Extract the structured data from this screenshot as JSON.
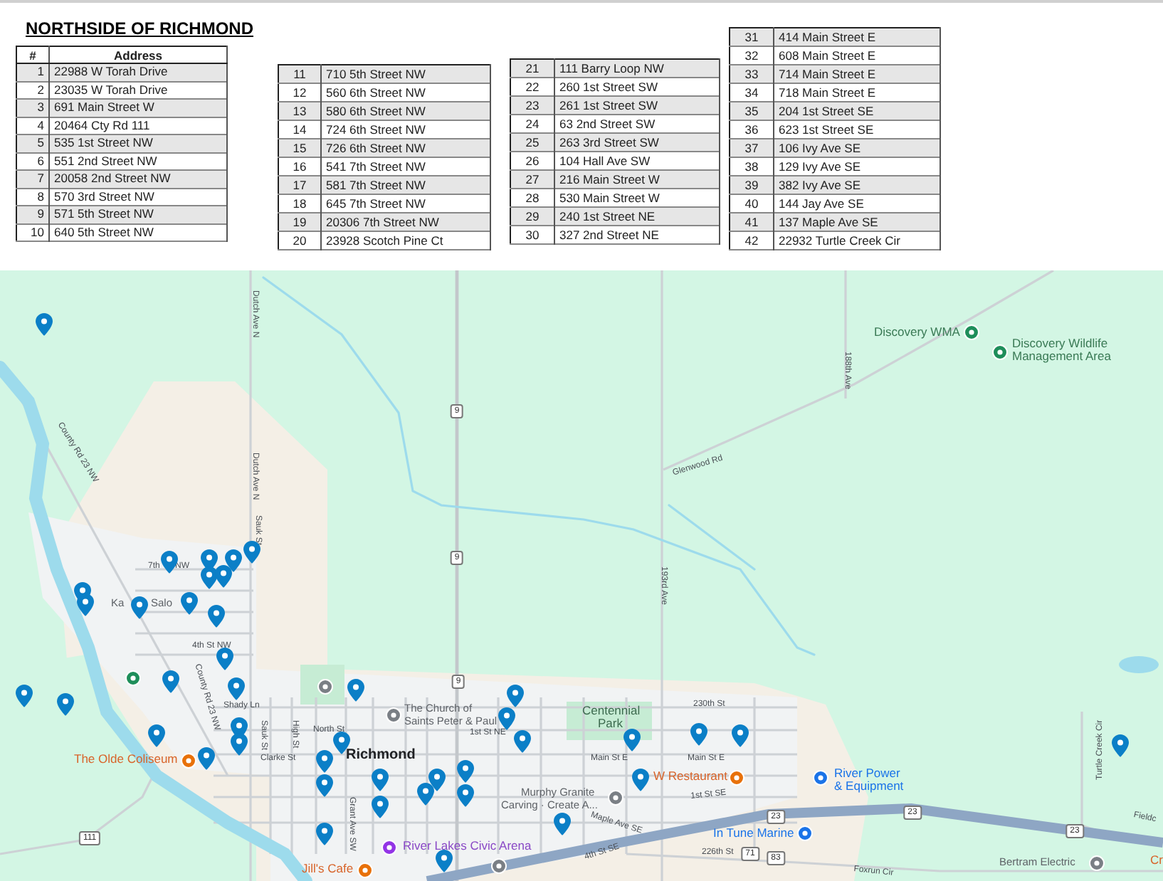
{
  "title": "NORTHSIDE OF RICHMOND",
  "tables": [
    {
      "columns": [
        "#",
        "Address"
      ],
      "rows": [
        {
          "num": "1",
          "address": "22988 W Torah Drive"
        },
        {
          "num": "2",
          "address": "23035 W Torah Drive"
        },
        {
          "num": "3",
          "address": "691 Main Street W"
        },
        {
          "num": "4",
          "address": "20464 Cty Rd 111"
        },
        {
          "num": "5",
          "address": "535 1st Street NW"
        },
        {
          "num": "6",
          "address": "551 2nd Street NW"
        },
        {
          "num": "7",
          "address": "20058 2nd Street NW"
        },
        {
          "num": "8",
          "address": "570 3rd Street NW"
        },
        {
          "num": "9",
          "address": "571 5th Street NW"
        },
        {
          "num": "10",
          "address": "640 5th Street NW"
        }
      ]
    },
    {
      "rows": [
        {
          "num": "11",
          "address": "710 5th Street NW"
        },
        {
          "num": "12",
          "address": "560 6th Street NW"
        },
        {
          "num": "13",
          "address": "580 6th Street NW"
        },
        {
          "num": "14",
          "address": "724 6th Street NW"
        },
        {
          "num": "15",
          "address": "726 6th Street NW"
        },
        {
          "num": "16",
          "address": "541 7th Street NW"
        },
        {
          "num": "17",
          "address": "581 7th Street NW"
        },
        {
          "num": "18",
          "address": "645 7th Street NW"
        },
        {
          "num": "19",
          "address": "20306 7th Street NW"
        },
        {
          "num": "20",
          "address": "23928 Scotch Pine Ct"
        }
      ]
    },
    {
      "rows": [
        {
          "num": "21",
          "address": "111 Barry Loop NW"
        },
        {
          "num": "22",
          "address": "260 1st Street SW"
        },
        {
          "num": "23",
          "address": "261 1st Street SW"
        },
        {
          "num": "24",
          "address": "63 2nd Street SW"
        },
        {
          "num": "25",
          "address": "263 3rd Street SW"
        },
        {
          "num": "26",
          "address": "104 Hall Ave SW"
        },
        {
          "num": "27",
          "address": "216 Main Street W"
        },
        {
          "num": "28",
          "address": "530 Main Street W"
        },
        {
          "num": "29",
          "address": "240 1st Street NE"
        },
        {
          "num": "30",
          "address": "327 2nd Street NE"
        }
      ]
    },
    {
      "rows": [
        {
          "num": "31",
          "address": "414 Main Street E"
        },
        {
          "num": "32",
          "address": "608 Main Street E"
        },
        {
          "num": "33",
          "address": "714 Main Street E"
        },
        {
          "num": "34",
          "address": "718 Main Street E"
        },
        {
          "num": "35",
          "address": "204 1st Street SE"
        },
        {
          "num": "36",
          "address": "623 1st Street SE"
        },
        {
          "num": "37",
          "address": "106 Ivy Ave SE"
        },
        {
          "num": "38",
          "address": "129 Ivy Ave SE"
        },
        {
          "num": "39",
          "address": "382 Ivy Ave SE"
        },
        {
          "num": "40",
          "address": "144 Jay Ave SE"
        },
        {
          "num": "41",
          "address": "137 Maple Ave SE"
        },
        {
          "num": "42",
          "address": "22932 Turtle Creek Cir"
        }
      ]
    }
  ],
  "map": {
    "labels": [
      {
        "text": "Dutch Ave N",
        "kind": "road"
      },
      {
        "text": "Discovery WMA",
        "kind": "poi-green"
      },
      {
        "text": "Discovery Wildlife",
        "kind": "poi-green"
      },
      {
        "text": "Management Area",
        "kind": "poi-green"
      },
      {
        "text": "188th Ave",
        "kind": "road"
      },
      {
        "text": "County Rd 23 NW",
        "kind": "road"
      },
      {
        "text": "Glenwood Rd",
        "kind": "road"
      },
      {
        "text": "Dutch Ave N",
        "kind": "road"
      },
      {
        "text": "Sauk St",
        "kind": "road"
      },
      {
        "text": "7th",
        "kind": "road"
      },
      {
        "text": "NW",
        "kind": "road"
      },
      {
        "text": "Ka",
        "kind": "place"
      },
      {
        "text": "Salo",
        "kind": "place"
      },
      {
        "text": "4th St NW",
        "kind": "road"
      },
      {
        "text": "193rd Ave",
        "kind": "road"
      },
      {
        "text": "Shady Ln",
        "kind": "road"
      },
      {
        "text": "230th St",
        "kind": "road"
      },
      {
        "text": "The Church of",
        "kind": "place"
      },
      {
        "text": "Saints Peter & Paul",
        "kind": "place"
      },
      {
        "text": "Centennial",
        "kind": "park"
      },
      {
        "text": "Park",
        "kind": "park"
      },
      {
        "text": "County Rd 23 NW",
        "kind": "road"
      },
      {
        "text": "Sauk St",
        "kind": "road"
      },
      {
        "text": "High St",
        "kind": "road"
      },
      {
        "text": "North St",
        "kind": "road"
      },
      {
        "text": "1st St NE",
        "kind": "road"
      },
      {
        "text": "The Olde Coliseum",
        "kind": "poi-orange"
      },
      {
        "text": "Clarke St",
        "kind": "road"
      },
      {
        "text": "Richmond",
        "kind": "town"
      },
      {
        "text": "Main St E",
        "kind": "road"
      },
      {
        "text": "Main St E",
        "kind": "road"
      },
      {
        "text": "W Restaurant",
        "kind": "poi-orange"
      },
      {
        "text": "River Power",
        "kind": "poi-blue"
      },
      {
        "text": "& Equipment",
        "kind": "poi-blue"
      },
      {
        "text": "Murphy Granite",
        "kind": "place"
      },
      {
        "text": "Carving · Create A...",
        "kind": "place"
      },
      {
        "text": "1st St SE",
        "kind": "road"
      },
      {
        "text": "Turtle Creek Cir",
        "kind": "road"
      },
      {
        "text": "Fieldc",
        "kind": "road"
      },
      {
        "text": "Maple Ave SE",
        "kind": "road"
      },
      {
        "text": "In Tune Marine",
        "kind": "poi-blue"
      },
      {
        "text": "Grant Ave SW",
        "kind": "road"
      },
      {
        "text": "River Lakes Civic Arena",
        "kind": "poi-purple"
      },
      {
        "text": "4th St SE",
        "kind": "road"
      },
      {
        "text": "226th St",
        "kind": "road"
      },
      {
        "text": "Foxrun Cir",
        "kind": "road"
      },
      {
        "text": "Bertram Electric",
        "kind": "place"
      },
      {
        "text": "Jill's Cafe",
        "kind": "poi-orange"
      },
      {
        "text": "Cr",
        "kind": "poi-orange"
      }
    ],
    "shields": [
      "9",
      "9",
      "9",
      "111",
      "23",
      "23",
      "23",
      "71",
      "83"
    ]
  }
}
